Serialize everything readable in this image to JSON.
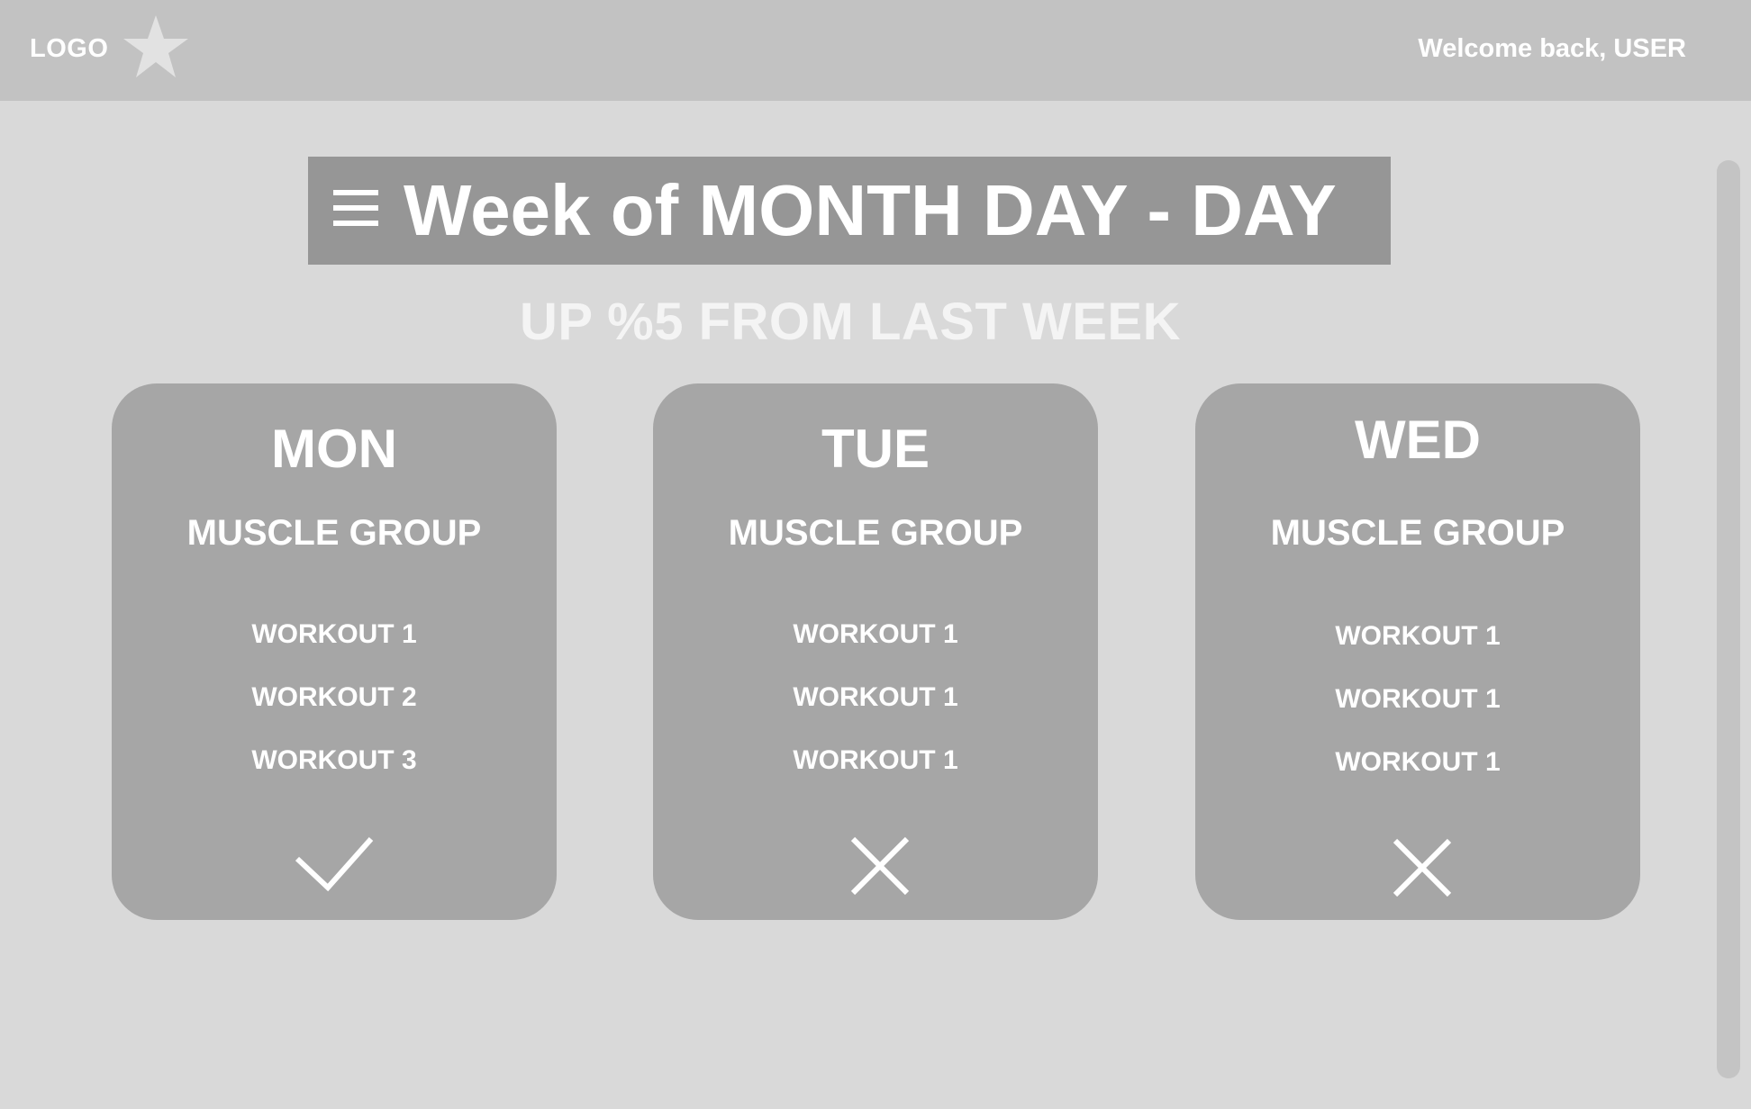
{
  "header": {
    "logo_text": "LOGO",
    "logo_icon": "star-icon",
    "welcome": "Welcome back, USER"
  },
  "banner": {
    "menu_icon": "hamburger-menu-icon",
    "title": "Week of MONTH DAY - DAY"
  },
  "summary": "UP %5 FROM LAST WEEK",
  "days": [
    {
      "day": "MON",
      "muscle_group": "MUSCLE GROUP",
      "workouts": [
        "WORKOUT 1",
        "WORKOUT 2",
        "WORKOUT 3"
      ],
      "status_icon": "checkmark-icon"
    },
    {
      "day": "TUE",
      "muscle_group": "MUSCLE GROUP",
      "workouts": [
        "WORKOUT 1",
        "WORKOUT 1",
        "WORKOUT 1"
      ],
      "status_icon": "close-icon"
    },
    {
      "day": "WED",
      "muscle_group": "MUSCLE GROUP",
      "workouts": [
        "WORKOUT 1",
        "WORKOUT 1",
        "WORKOUT 1"
      ],
      "status_icon": "close-icon"
    }
  ],
  "colors": {
    "background": "#d9d9d9",
    "header": "#c2c2c2",
    "banner": "#969696",
    "card": "#a6a6a6",
    "text": "#ffffff"
  }
}
